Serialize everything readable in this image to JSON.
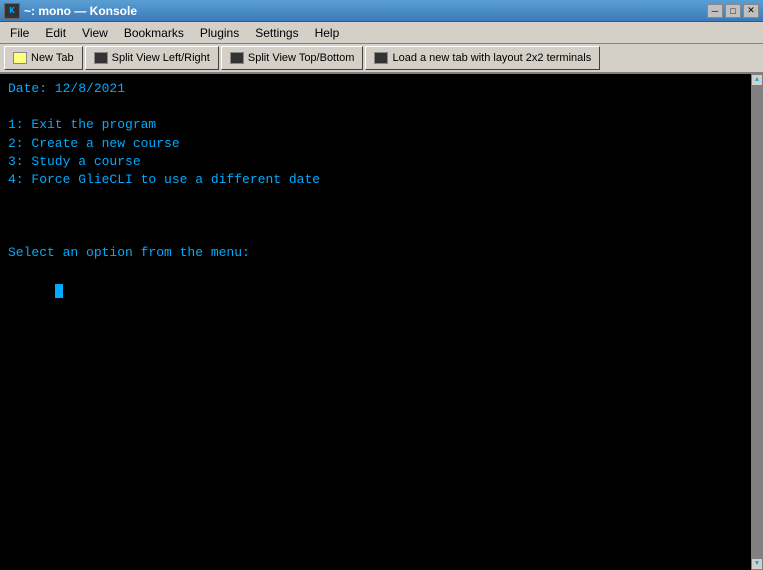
{
  "titlebar": {
    "title": "~: mono — Konsole",
    "icon_label": "K"
  },
  "menubar": {
    "items": [
      "File",
      "Edit",
      "View",
      "Bookmarks",
      "Plugins",
      "Settings",
      "Help"
    ]
  },
  "toolbar": {
    "buttons": [
      {
        "label": "New Tab",
        "icon": "tab"
      },
      {
        "label": "Split View Left/Right",
        "icon": "split-lr"
      },
      {
        "label": "Split View Top/Bottom",
        "icon": "split-tb"
      },
      {
        "label": "Load a new tab with layout 2x2 terminals",
        "icon": "grid"
      }
    ]
  },
  "terminal": {
    "date_line": "Date: 12/8/2021",
    "menu_items": [
      "1: Exit the program",
      "2: Create a new course",
      "3: Study a course",
      "4: Force GlieCLI to use a different date"
    ],
    "prompt": "Select an option from the menu:"
  }
}
